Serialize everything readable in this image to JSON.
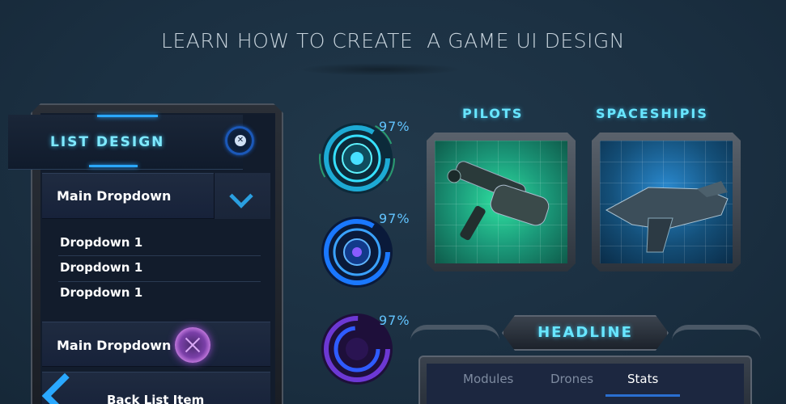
{
  "title": "LEARN HOW TO CREATE  A GAME UI DESIGN",
  "list_panel": {
    "heading": "LIST DESIGN",
    "close_icon": "close-x-icon",
    "main_dropdown_1": "Main Dropdown",
    "sub_items": [
      "Dropdown 1",
      "Dropdown 1",
      "Dropdown 1"
    ],
    "main_dropdown_2": "Main Dropdown",
    "back_item": "Back List Item"
  },
  "progress": [
    {
      "label": "97%",
      "value": 97,
      "color": "#1fb8e6"
    },
    {
      "label": "97%",
      "value": 97,
      "color": "#1a78ff"
    },
    {
      "label": "97%",
      "value": 97,
      "color": "#7a3ff0"
    }
  ],
  "cards": {
    "pilots_label": "PILOTS",
    "spaceships_label": "SPACESHIPIS"
  },
  "headline_panel": {
    "title": "HEADLINE",
    "tabs": [
      "Modules",
      "Drones",
      "Stats"
    ],
    "active_tab": "Stats"
  },
  "colors": {
    "accent_cyan": "#68e6ff",
    "accent_blue": "#2aa8ff",
    "background": "#1b3042"
  }
}
